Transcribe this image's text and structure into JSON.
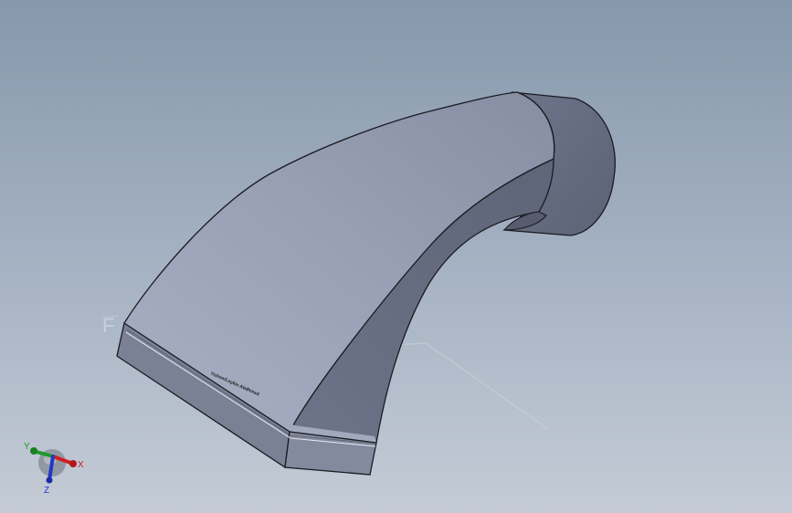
{
  "viewport": {
    "background_top": "#8798ac",
    "background_bottom": "#c4cbd6"
  },
  "model": {
    "surface_label": "Yizhmr/Leykin Abdhmsd",
    "plane_label": "F",
    "colors": {
      "top_face": "#9ba2b8",
      "side_face": "#6c7387",
      "end_face": "#7b8296",
      "flange": "#6a7083",
      "edge": "#1b1b22"
    }
  },
  "triad": {
    "x_label": "X",
    "y_label": "Y",
    "z_label": "Z",
    "x_color": "#d02020",
    "y_color": "#1f9a2a",
    "z_color": "#2236c8"
  }
}
